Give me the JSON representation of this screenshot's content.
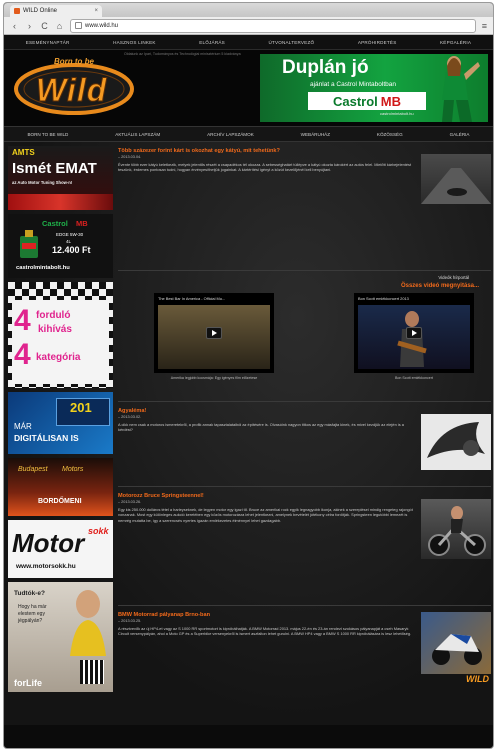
{
  "browser": {
    "tab_title": "WILD Online",
    "tab_close": "×",
    "url": "www.wild.hu",
    "back": "‹",
    "forward": "›",
    "reload": "C",
    "home": "⌂",
    "menu": "≡"
  },
  "topnav": [
    "ESEMÉNYNAPTÁR",
    "HASZNOS LINKEK",
    "ELŐJÁRÁS",
    "ÚTVONALTERVEZŐ",
    "APRÓHIRDETÉS",
    "KÉPGALÉRIA"
  ],
  "header": {
    "note": "Oldalunk az Ipari, Tudományos és Technológiai minisztérium 5 kiadványa",
    "logo_top": "Born to be",
    "logo_main": "Wild",
    "ad": {
      "title": "Duplán jó",
      "subtitle": "ajánlat a Castrol Mintaboltban",
      "brand": "Castrol",
      "brand_suffix": "MB",
      "url": "castrolmintabolt.hu"
    }
  },
  "subnav": [
    "BORN TO BE WILD",
    "AKTUÁLIS LAPSZÁM",
    "ARCHÍV LAPSZÁMOK",
    "WEBÁRUHÁZ",
    "KÖZÖSSÉG",
    "GALÉRIA"
  ],
  "sidebar": {
    "ad1": {
      "top": "AMTS",
      "main": "Ismét EMAT",
      "sub": "az Auto Motor Tuning Show-n!"
    },
    "ad2": {
      "brand": "Castrol",
      "brand_suffix": "MB",
      "spec1": "EDGE 5W-30",
      "spec2": "4L",
      "price": "12.400 Ft",
      "url": "castrolmintabolt.hu"
    },
    "ad3": {
      "line1": "4",
      "line2": "forduló",
      "line3": "kihívás",
      "line4": "4",
      "line5": "kategória"
    },
    "ad4": {
      "year": "201",
      "line1": "MÁR",
      "line2": "DIGITÁLISAN IS"
    },
    "ad5": {
      "line1": "Budapest",
      "line2": "Motors",
      "line3": "BORDŐMENI"
    },
    "ad6": {
      "brand": "Motor",
      "suffix": "sokk",
      "url": "www.motorsokk.hu"
    },
    "ad7": {
      "q1": "Tudtók-e?",
      "q2": "Hogy ha már",
      "q3": "elestem egy",
      "q4": "jégpályán?",
      "brand": "forLife"
    }
  },
  "articles": [
    {
      "title": "Több százezer forint kárt is okozhat egy kátyú, mit tehetünk?",
      "date": "– 2013.03.04.",
      "body": "Évente több ezer kátyú keletkezik, melyek jelentős részét a csapadékos tél okozza. A sebességhatárt túllépve a kátyú okozta károkért az autós felel. Mielőtt kárbejelentést teszünk, érdemes pontosan tudni, hogyan érvényesíthetjük jogainkat. A kártérítési igényt a közút kezelőjénél kell benyújtani."
    },
    {
      "title": "Agyaléma!",
      "date": "– 2013.03.02.",
      "body": "A cikk nem csak a motoros ismeretekről, a profik annak tapasztalataiból az építésére is. Olvasóink nagyon titkos az egy másfajta kinek, és mivel kezdjük az elején is a kérdést?"
    },
    {
      "title": "Motorozz Bruce Springsteennel!",
      "date": "– 2013.03.26.",
      "body": "Egy kis 250.000 dolláros tétel a harleyseknek, de legyen motor egy igazi tő. Bruce az amerikai rock egyik legnagyobb ikonja, akinek a szereplései mindig rengeteg rajongót vonzanak. Most egy különleges aukció keretében egy közös motorozásra lehet jelentkezni, amelynek bevételét jótékony célra fordítják. Springsteen legutóbbi lemezét is nemrég mutatta be, így a szerencsés nyertes igazán emlékezetes élménnyel lehet gazdagabb."
    },
    {
      "title": "BMW Motorrad pályanap Brno-ban",
      "date": "– 2013.03.25.",
      "body": "A résztvevők az új HP4-et vagy az S 1000 RR sportmotort is kipróbálhatják. A BMW Motorrad 2013. május 22-én és 23-án rendezi szokásos pályanapját a cseh Masaryk Circuit versenypályán, ahol a Moto GP és a Superbike versenyekről is ismert aszfalton lehet gurulni. A BMW HP4 vagy a BMW S 1000 RR kipróbálására is lesz lehetőség."
    }
  ],
  "videos": {
    "heading1": "Videók hírportál",
    "heading2": "Összes videó megnyitása...",
    "items": [
      {
        "title": "The Best Bar In America - Official Mu...",
        "caption": "Amerika legjobb kocsmája: Egy igényes film előzetese"
      },
      {
        "title": "Bon Scott emlékkoncert 2013",
        "caption": "Bon Scott emlékkoncert"
      }
    ]
  },
  "footer_badge": "WILD"
}
